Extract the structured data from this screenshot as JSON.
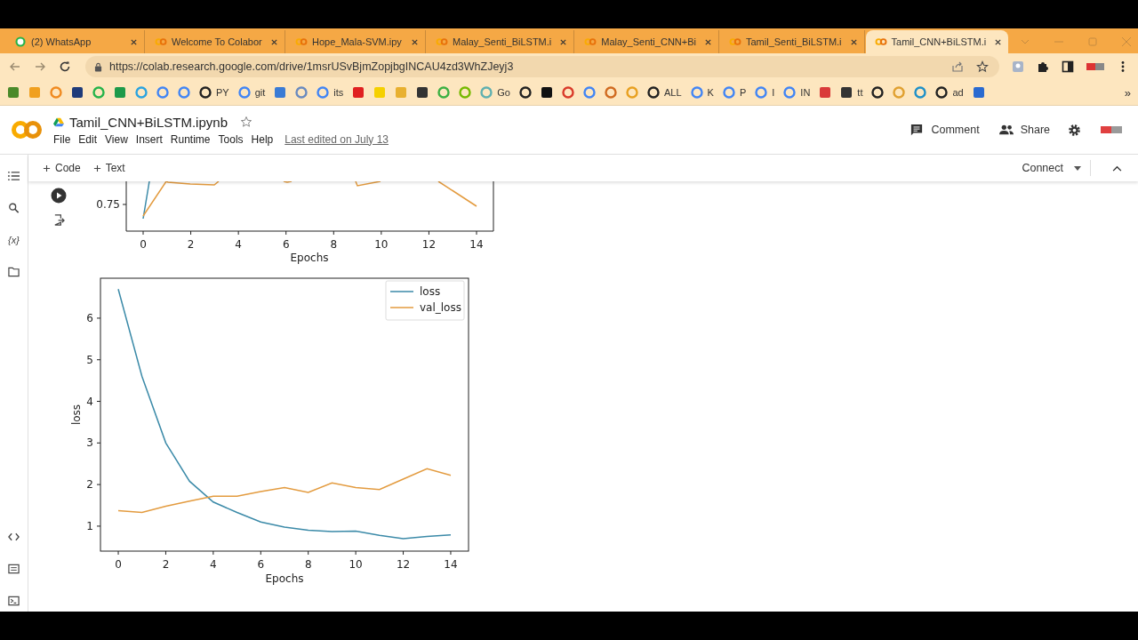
{
  "browser": {
    "tabs": [
      {
        "label": "(2) WhatsApp",
        "kind": "chat",
        "selected": false
      },
      {
        "label": "Welcome To Colabor",
        "kind": "colab",
        "selected": false
      },
      {
        "label": "Hope_Mala-SVM.ipy",
        "kind": "colab",
        "selected": false
      },
      {
        "label": "Malay_Senti_BiLSTM.i",
        "kind": "colab",
        "selected": false
      },
      {
        "label": "Malay_Senti_CNN+Bi",
        "kind": "colab",
        "selected": false
      },
      {
        "label": "Tamil_Senti_BiLSTM.i",
        "kind": "colab",
        "selected": false
      },
      {
        "label": "Tamil_CNN+BiLSTM.i",
        "kind": "colab",
        "selected": true
      }
    ],
    "address": "https://colab.research.google.com/drive/1msrUSvBjmZopjbgINCAU4zd3WhZJeyj3",
    "bookmarks": [
      {
        "kind": "icon"
      },
      {
        "kind": "icon"
      },
      {
        "kind": "icon"
      },
      {
        "kind": "icon"
      },
      {
        "kind": "icon"
      },
      {
        "kind": "icon"
      },
      {
        "kind": "icon"
      },
      {
        "kind": "icon"
      },
      {
        "kind": "icon"
      },
      {
        "kind": "labeled",
        "label": "PY"
      },
      {
        "kind": "labeled",
        "label": "git"
      },
      {
        "kind": "icon"
      },
      {
        "kind": "icon"
      },
      {
        "kind": "labeled",
        "label": "its"
      },
      {
        "kind": "icon"
      },
      {
        "kind": "icon"
      },
      {
        "kind": "icon"
      },
      {
        "kind": "icon"
      },
      {
        "kind": "icon"
      },
      {
        "kind": "icon"
      },
      {
        "kind": "labeled",
        "label": "Go"
      },
      {
        "kind": "icon"
      },
      {
        "kind": "icon"
      },
      {
        "kind": "icon"
      },
      {
        "kind": "icon"
      },
      {
        "kind": "icon"
      },
      {
        "kind": "icon"
      },
      {
        "kind": "labeled",
        "label": "ALL"
      },
      {
        "kind": "labeled",
        "label": "K"
      },
      {
        "kind": "labeled",
        "label": "P"
      },
      {
        "kind": "labeled",
        "label": "I"
      },
      {
        "kind": "labeled",
        "label": "IN"
      },
      {
        "kind": "icon"
      },
      {
        "kind": "labeled",
        "label": "tt"
      },
      {
        "kind": "icon"
      },
      {
        "kind": "icon"
      },
      {
        "kind": "icon"
      },
      {
        "kind": "labeled",
        "label": "ad"
      },
      {
        "kind": "icon"
      }
    ],
    "more_bookmarks": "»"
  },
  "notebook": {
    "title": "Tamil_CNN+BiLSTM.ipynb",
    "menu": [
      "File",
      "Edit",
      "View",
      "Insert",
      "Runtime",
      "Tools",
      "Help"
    ],
    "last_edited": "Last edited on July 13",
    "actions": [
      {
        "kind": "comment",
        "label": "Comment"
      },
      {
        "kind": "share",
        "label": "Share"
      }
    ],
    "toolbar": {
      "add_buttons": [
        "Code",
        "Text"
      ],
      "connect": "Connect"
    },
    "sidebar": {
      "variables_icon": "{x}"
    }
  },
  "output": {
    "accuracy_plot": {
      "ytick_labels": [
        "0.75"
      ],
      "xtick_labels": [
        "0",
        "2",
        "4",
        "6",
        "8",
        "10",
        "12",
        "14"
      ],
      "xlabel": "Epochs"
    },
    "loss_plot": {
      "chart_data": {
        "type": "line",
        "xlabel": "Epochs",
        "ylabel": "loss",
        "x": [
          0,
          1,
          2,
          3,
          4,
          5,
          6,
          7,
          8,
          9,
          10,
          11,
          12,
          13,
          14
        ],
        "series": [
          {
            "name": "loss",
            "color": "#3b8aa8",
            "values": [
              6.7,
              4.6,
              3.0,
              2.08,
              1.58,
              1.33,
              1.1,
              0.98,
              0.9,
              0.87,
              0.88,
              0.78,
              0.7,
              0.75,
              0.79
            ]
          },
          {
            "name": "val_loss",
            "color": "#e39b3f",
            "values": [
              1.37,
              1.33,
              1.48,
              1.6,
              1.72,
              1.72,
              1.83,
              1.93,
              1.81,
              2.04,
              1.93,
              1.88,
              2.13,
              2.38,
              2.22
            ]
          }
        ],
        "legend": "upper right",
        "xlim": [
          -0.75,
          14.75
        ],
        "ylim": [
          0.4,
          6.96
        ],
        "xticks": [
          0,
          2,
          4,
          6,
          8,
          10,
          12,
          14
        ],
        "yticks": [
          1,
          2,
          3,
          4,
          5,
          6
        ]
      }
    }
  }
}
